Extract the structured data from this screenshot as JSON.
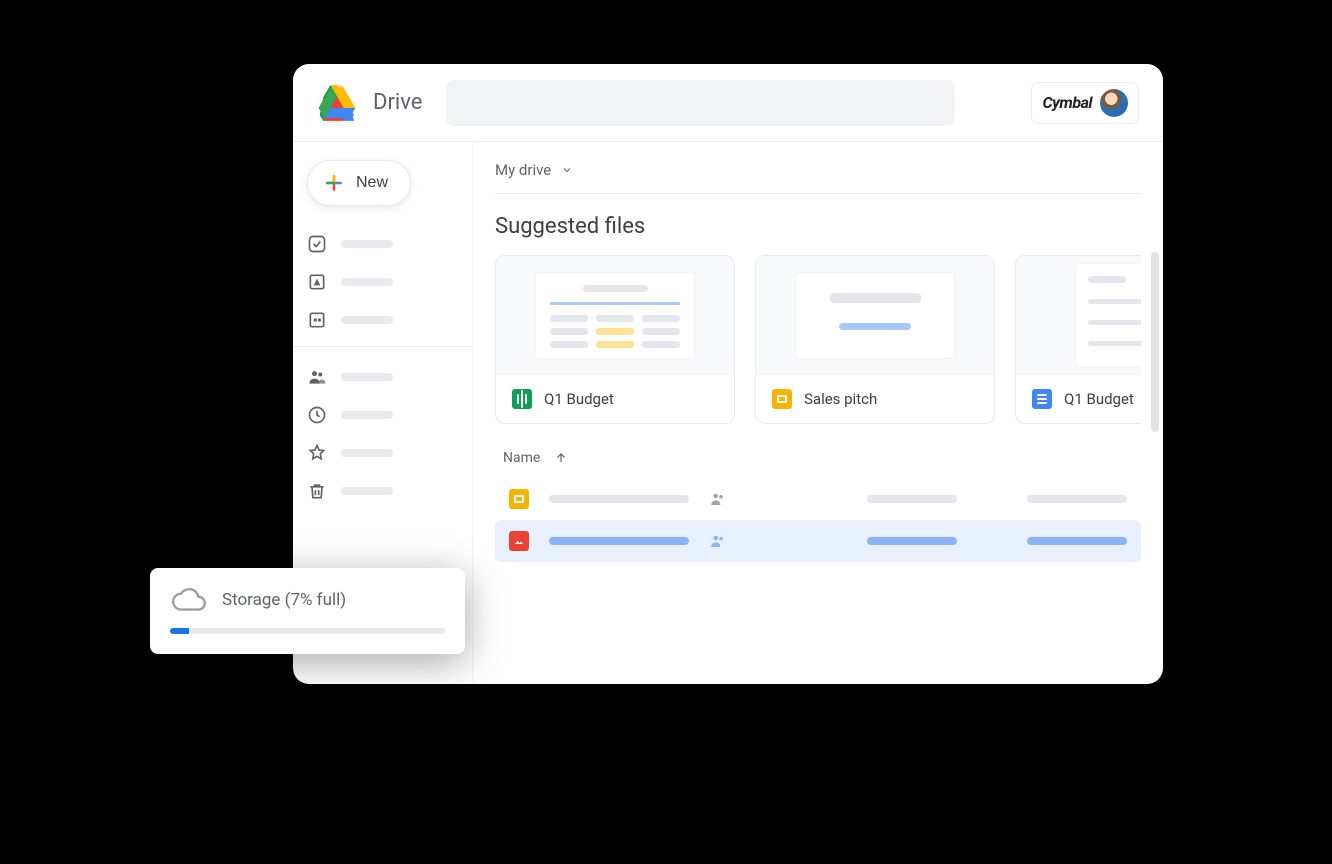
{
  "header": {
    "app_name": "Drive",
    "brand_name": "Cymbal"
  },
  "sidebar": {
    "new_label": "New"
  },
  "main": {
    "breadcrumb": "My drive",
    "section_title": "Suggested files",
    "cards": [
      {
        "name": "Q1 Budget",
        "type": "sheets"
      },
      {
        "name": "Sales pitch",
        "type": "slides"
      },
      {
        "name": "Q1 Budget",
        "type": "docs"
      }
    ],
    "table": {
      "sort_column": "Name"
    }
  },
  "storage": {
    "label": "Storage (7% full)",
    "percent": 7
  }
}
